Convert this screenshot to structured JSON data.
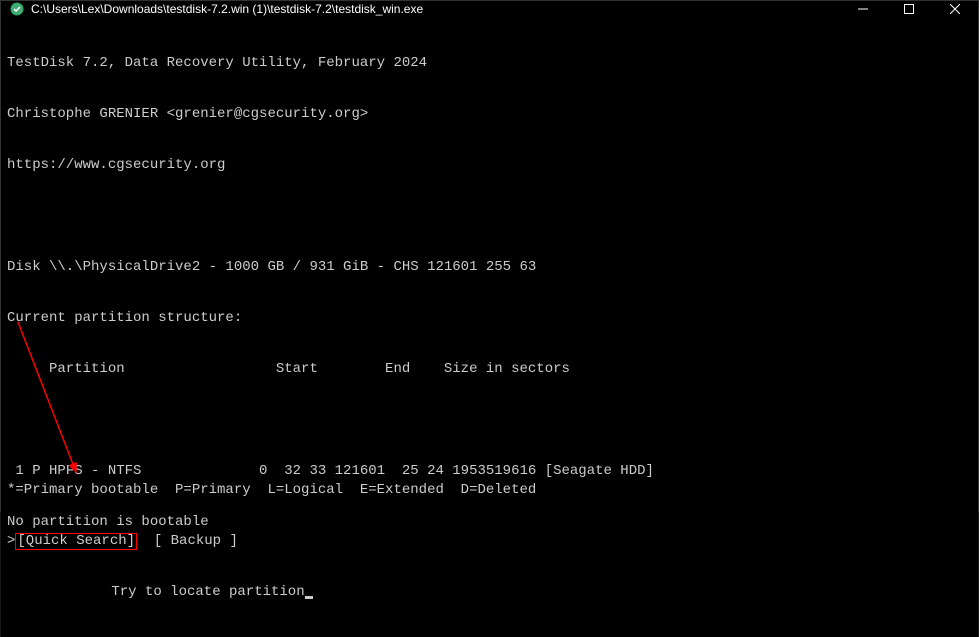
{
  "titlebar": {
    "title": "C:\\Users\\Lex\\Downloads\\testdisk-7.2.win (1)\\testdisk-7.2\\testdisk_win.exe"
  },
  "header": {
    "line1": "TestDisk 7.2, Data Recovery Utility, February 2024",
    "line2": "Christophe GRENIER <grenier@cgsecurity.org>",
    "line3": "https://www.cgsecurity.org"
  },
  "disk_info": {
    "disk_line": "Disk \\\\.\\PhysicalDrive2 - 1000 GB / 931 GiB - CHS 121601 255 63",
    "structure_label": "Current partition structure:",
    "header_row": "     Partition                  Start        End    Size in sectors"
  },
  "partition": {
    "row": " 1 P HPFS - NTFS              0  32 33 121601  25 24 1953519616 [Seagate HDD]",
    "warning": "No partition is bootable"
  },
  "legend": "*=Primary bootable  P=Primary  L=Logical  E=Extended  D=Deleted",
  "menu": {
    "prefix": ">",
    "quick_search": "[Quick Search]",
    "spacer": "  ",
    "backup": "[ Backup ]"
  },
  "hint": "Try to locate partition"
}
